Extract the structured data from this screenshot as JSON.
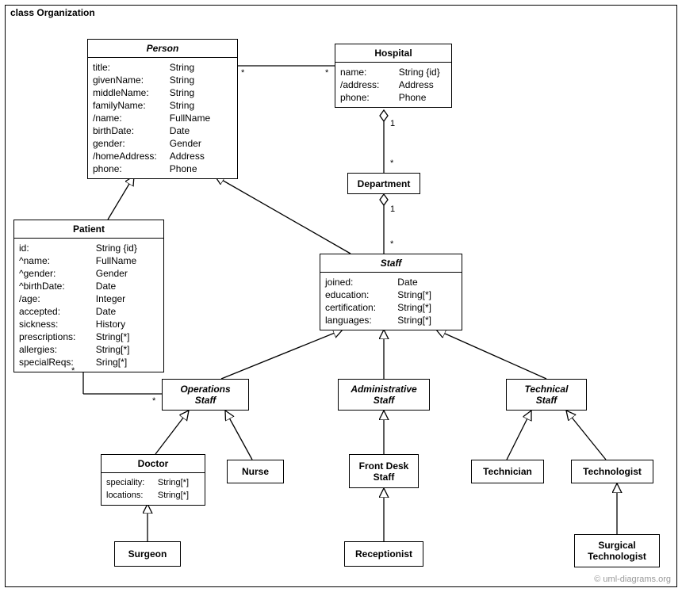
{
  "package_label": "class Organization",
  "watermark": "© uml-diagrams.org",
  "classes": {
    "person": {
      "name": "Person",
      "attrs": [
        {
          "k": "title:",
          "v": "String"
        },
        {
          "k": "givenName:",
          "v": "String"
        },
        {
          "k": "middleName:",
          "v": "String"
        },
        {
          "k": "familyName:",
          "v": "String"
        },
        {
          "k": "/name:",
          "v": "FullName"
        },
        {
          "k": "birthDate:",
          "v": "Date"
        },
        {
          "k": "gender:",
          "v": "Gender"
        },
        {
          "k": "/homeAddress:",
          "v": "Address"
        },
        {
          "k": "phone:",
          "v": "Phone"
        }
      ]
    },
    "hospital": {
      "name": "Hospital",
      "attrs": [
        {
          "k": "name:",
          "v": "String {id}"
        },
        {
          "k": "/address:",
          "v": "Address"
        },
        {
          "k": "phone:",
          "v": "Phone"
        }
      ]
    },
    "department": {
      "name": "Department"
    },
    "patient": {
      "name": "Patient",
      "attrs": [
        {
          "k": "id:",
          "v": "String {id}"
        },
        {
          "k": "^name:",
          "v": "FullName"
        },
        {
          "k": "^gender:",
          "v": "Gender"
        },
        {
          "k": "^birthDate:",
          "v": "Date"
        },
        {
          "k": "/age:",
          "v": "Integer"
        },
        {
          "k": "accepted:",
          "v": "Date"
        },
        {
          "k": "sickness:",
          "v": "History"
        },
        {
          "k": "prescriptions:",
          "v": "String[*]"
        },
        {
          "k": "allergies:",
          "v": "String[*]"
        },
        {
          "k": "specialReqs:",
          "v": "Sring[*]"
        }
      ]
    },
    "staff": {
      "name": "Staff",
      "attrs": [
        {
          "k": "joined:",
          "v": "Date"
        },
        {
          "k": "education:",
          "v": "String[*]"
        },
        {
          "k": "certification:",
          "v": "String[*]"
        },
        {
          "k": "languages:",
          "v": "String[*]"
        }
      ]
    },
    "operations_staff": {
      "name": "Operations\nStaff"
    },
    "administrative_staff": {
      "name": "Administrative\nStaff"
    },
    "technical_staff": {
      "name": "Technical\nStaff"
    },
    "doctor": {
      "name": "Doctor",
      "attrs": [
        {
          "k": "speciality:",
          "v": "String[*]"
        },
        {
          "k": "locations:",
          "v": "String[*]"
        }
      ]
    },
    "nurse": {
      "name": "Nurse"
    },
    "front_desk_staff": {
      "name": "Front Desk\nStaff"
    },
    "technician": {
      "name": "Technician"
    },
    "technologist": {
      "name": "Technologist"
    },
    "surgeon": {
      "name": "Surgeon"
    },
    "receptionist": {
      "name": "Receptionist"
    },
    "surgical_technologist": {
      "name": "Surgical\nTechnologist"
    }
  },
  "multiplicities": {
    "person_hospital_left": "*",
    "person_hospital_right": "*",
    "hospital_dept_top": "1",
    "hospital_dept_bottom": "*",
    "dept_staff_top": "1",
    "dept_staff_bottom": "*",
    "patient_ops_patient": "*",
    "patient_ops_ops": "*"
  }
}
